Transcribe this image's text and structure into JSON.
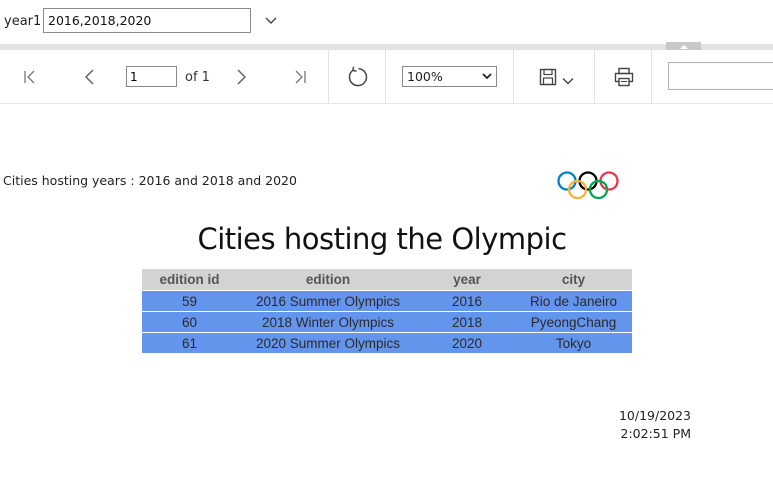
{
  "parameters": {
    "label": "year1",
    "value": "2016,2018,2020"
  },
  "toolbar": {
    "page_current": "1",
    "page_of": "of 1",
    "zoom": "100%",
    "zoom_options": [
      "100%"
    ],
    "find_value": ""
  },
  "report": {
    "subtitle": "Cities hosting years :  2016 and 2018 and 2020",
    "title": "Cities hosting the Olympic",
    "table": {
      "headers": [
        "edition id",
        "edition",
        "year",
        "city"
      ],
      "rows": [
        [
          "59",
          "2016 Summer Olympics",
          "2016",
          "Rio de Janeiro"
        ],
        [
          "60",
          "2018 Winter Olympics",
          "2018",
          "PyeongChang"
        ],
        [
          "61",
          "2020 Summer Olympics",
          "2020",
          "Tokyo"
        ]
      ]
    },
    "date": "10/19/2023",
    "time": "2:02:51 PM"
  },
  "colors": {
    "header_bg": "#d3d3d3",
    "row_bg": "#6495ed",
    "ring_blue": "#0081c8",
    "ring_yellow": "#fcb131",
    "ring_black": "#000000",
    "ring_green": "#00a651",
    "ring_red": "#ee334e"
  }
}
